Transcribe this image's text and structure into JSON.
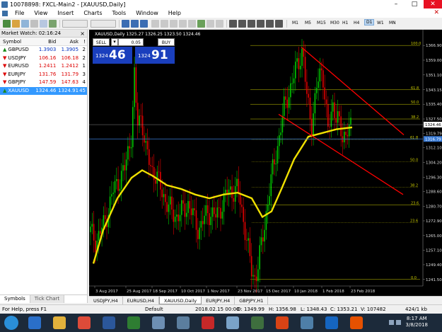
{
  "window": {
    "title": "10078898: FXCL-Main2 - [XAUUSD,Daily]",
    "minimize": "–",
    "maximize": "□",
    "close": "✕"
  },
  "menu": {
    "items": [
      "File",
      "View",
      "Insert",
      "Charts",
      "Tools",
      "Window",
      "Help"
    ],
    "close": "✕"
  },
  "toolbar": {
    "timeframes": [
      "M1",
      "M5",
      "M15",
      "M30",
      "H1",
      "H4",
      "D1",
      "W1",
      "MN"
    ],
    "active_timeframe": "D1"
  },
  "market_watch": {
    "header": "Market Watch: 02:16:24",
    "close": "×",
    "columns": [
      "Symbol",
      "Bid",
      "Ask",
      "!"
    ],
    "rows": [
      {
        "symbol": "GBPUSD",
        "bid": "1.3903",
        "ask": "1.3905",
        "spread": "2",
        "dir": "up"
      },
      {
        "symbol": "USDJPY",
        "bid": "106.16",
        "ask": "106.18",
        "spread": "2",
        "dir": "down"
      },
      {
        "symbol": "EURUSD",
        "bid": "1.2411",
        "ask": "1.2412",
        "spread": "1",
        "dir": "down"
      },
      {
        "symbol": "EURJPY",
        "bid": "131.76",
        "ask": "131.79",
        "spread": "3",
        "dir": "down"
      },
      {
        "symbol": "GBPJPY",
        "bid": "147.59",
        "ask": "147.63",
        "spread": "4",
        "dir": "down"
      },
      {
        "symbol": "XAUUSD",
        "bid": "1324.46",
        "ask": "1324.91",
        "spread": "45",
        "dir": "up",
        "selected": true
      }
    ],
    "tabs": [
      "Symbols",
      "Tick Chart"
    ]
  },
  "chart": {
    "info": "XAUUSD,Daily  1325.27 1326.25 1323.50 1324.46",
    "one_click": {
      "sell": "SELL",
      "buy": "BUY",
      "lot": "0.05",
      "bid_small": "1324",
      "bid_big": "46",
      "ask_small": "1324",
      "ask_big": "91"
    },
    "colors": {
      "background": "#000000",
      "bull": "#00c800",
      "bear": "#e00000",
      "ma": "#f0e000",
      "channel": "#ff0000",
      "fib": "#c8c800"
    }
  },
  "chart_data": {
    "type": "candlestick",
    "symbol": "XAUUSD",
    "timeframe": "Daily",
    "price_axis": [
      "1366.90",
      "1359.00",
      "1351.10",
      "1343.15",
      "1335.40",
      "1327.50",
      "1319.79",
      "1312.10",
      "1304.20",
      "1296.30",
      "1288.60",
      "1280.70",
      "1272.90",
      "1265.00",
      "1257.10",
      "1249.40",
      "1241.50"
    ],
    "ylim": [
      1238,
      1370
    ],
    "current_bid": "1324.46",
    "current_ask": "1316.79",
    "time_axis": [
      "3 Aug 2017",
      "25 Aug 2017",
      "18 Sep 2017",
      "10 Oct 2017",
      "1 Nov 2017",
      "23 Nov 2017",
      "15 Dec 2017",
      "10 Jan 2018",
      "1 Feb 2018",
      "23 Feb 2018"
    ],
    "fibonacci_levels": [
      "100.0",
      "61.8",
      "50.0",
      "38.2",
      "23.6",
      "0.0"
    ],
    "fibonacci_levels_second": [
      "61.8",
      "50.0",
      "38.2",
      "23.6",
      "0.0"
    ]
  },
  "chart_tabs": [
    "USDJPY,H4",
    "EURUSD,H4",
    "XAUUSD,Daily",
    "EURJPY,H4",
    "GBPJPY,H1"
  ],
  "active_chart_tab": "XAUUSD,Daily",
  "status": {
    "help": "For Help, press F1",
    "profile": "Default",
    "datetime": "2018.02.15 00:00",
    "open": "O: 1349.99",
    "high": "H: 1356.98",
    "low": "L: 1348.43",
    "close": "C: 1353.21",
    "volume": "V: 107482",
    "traffic": "424/1 kb"
  },
  "taskbar": {
    "time": "8:17 AM",
    "date": "3/8/2018"
  }
}
